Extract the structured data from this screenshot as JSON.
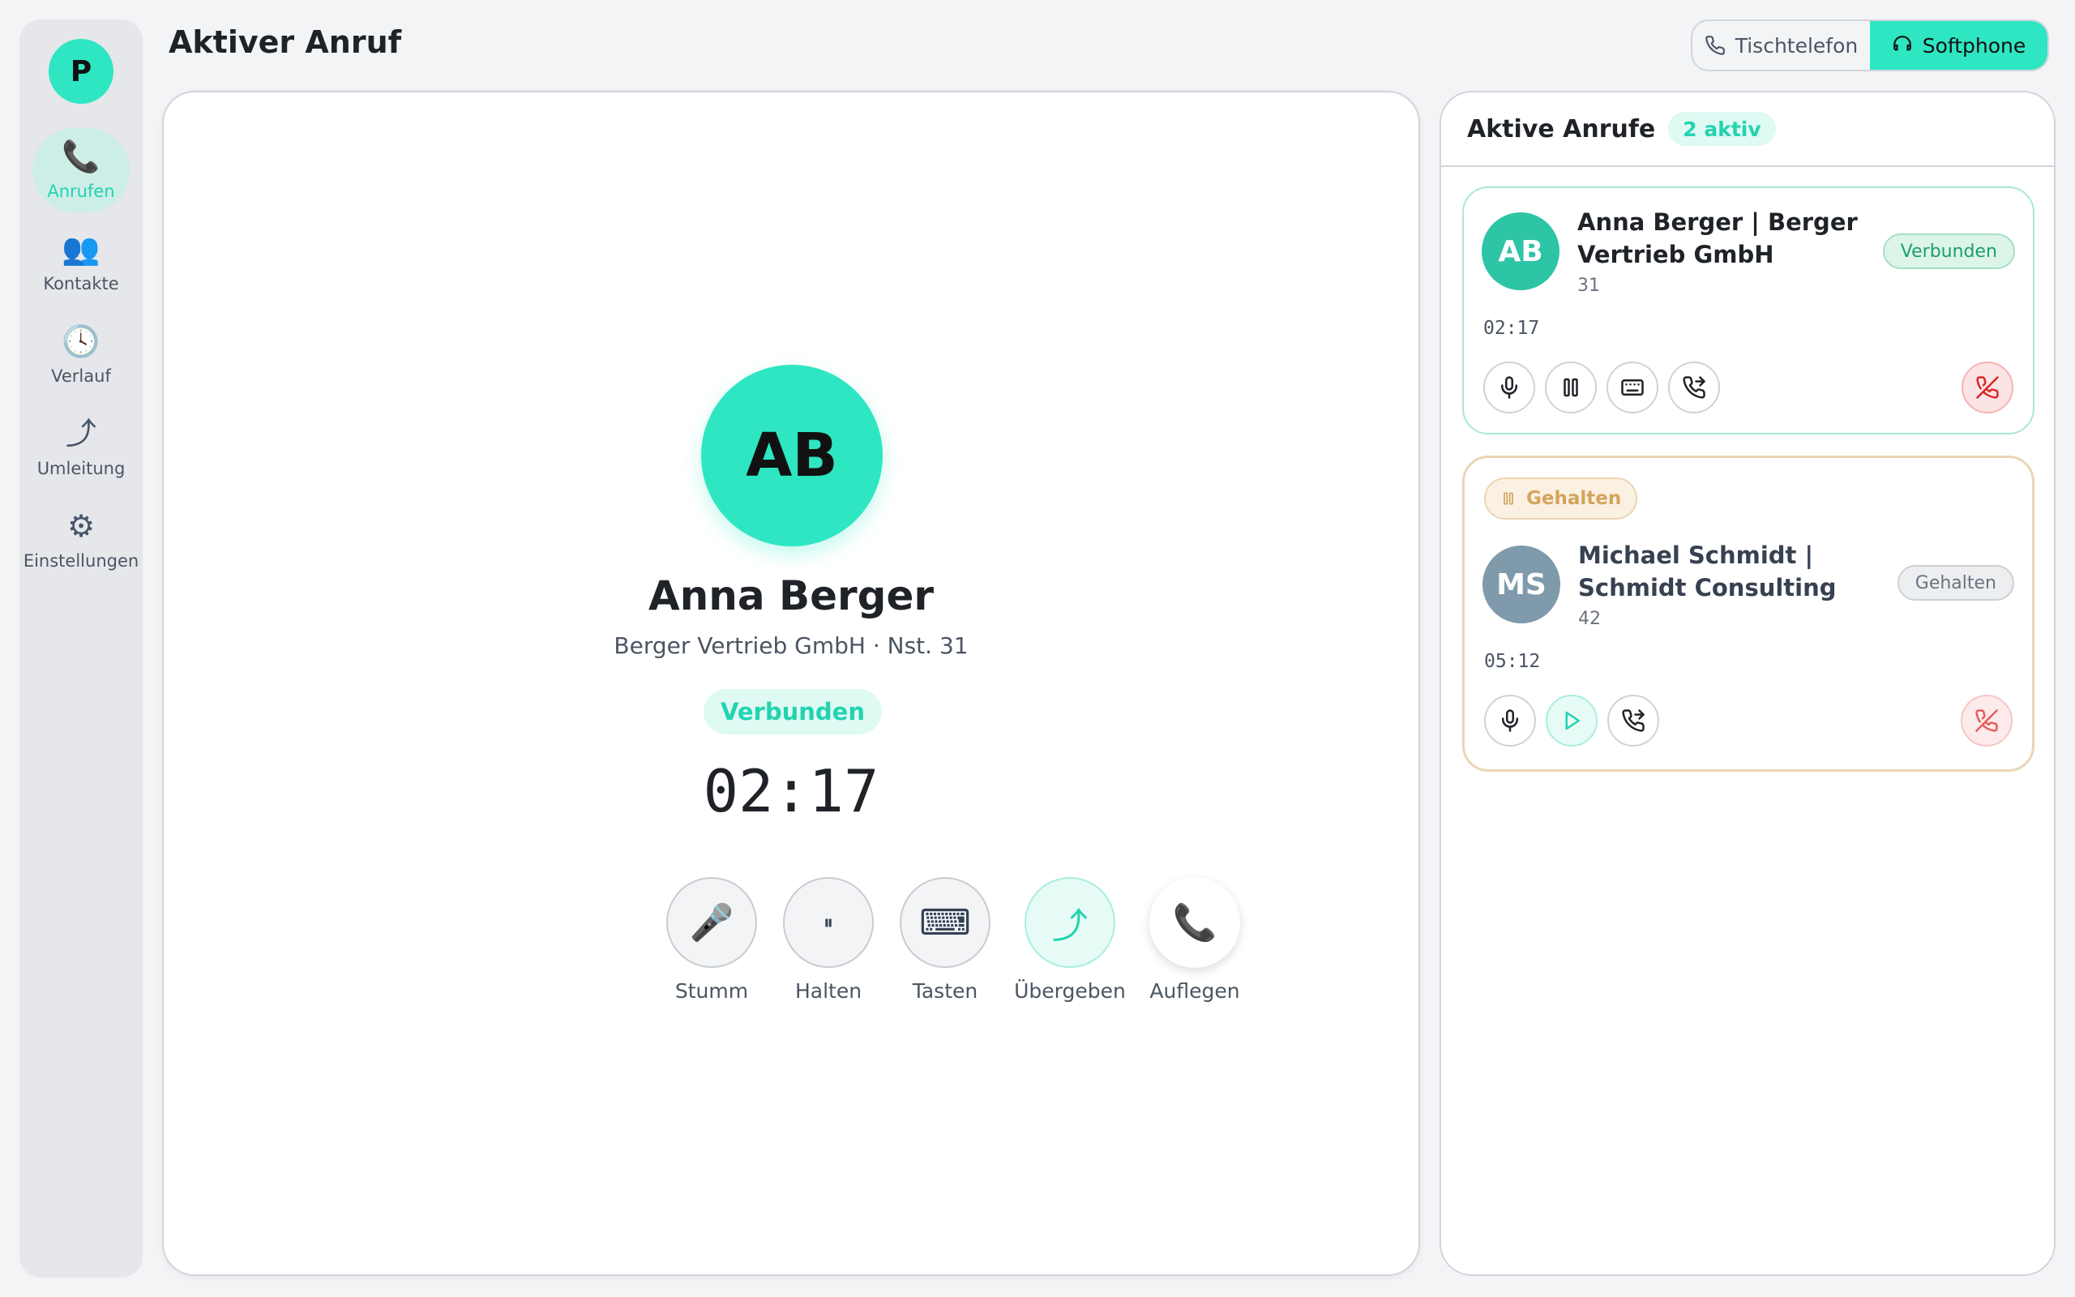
{
  "app": {
    "logo_letter": "P"
  },
  "sidebar": {
    "items": [
      {
        "icon": "phone-icon",
        "glyph": "📞",
        "label": "Anrufen",
        "active": true
      },
      {
        "icon": "contacts-icon",
        "glyph": "👥",
        "label": "Kontakte",
        "active": false
      },
      {
        "icon": "clock-icon",
        "glyph": "🕓",
        "label": "Verlauf",
        "active": false
      },
      {
        "icon": "forward-arrow-icon",
        "glyph": "⤴",
        "label": "Umleitung",
        "active": false
      },
      {
        "icon": "gear-icon",
        "glyph": "⚙",
        "label": "Einstellungen",
        "active": false
      }
    ]
  },
  "header": {
    "title": "Aktiver Anruf",
    "modes": {
      "desk": "Tischtelefon",
      "soft": "Softphone",
      "active": "Softphone"
    }
  },
  "current_call": {
    "initials": "AB",
    "name": "Anna Berger",
    "subtitle": "Berger Vertrieb GmbH · Nst. 31",
    "status": "Verbunden",
    "timer": "02:17",
    "controls": {
      "mute": {
        "glyph": "🎤",
        "label": "Stumm"
      },
      "hold": {
        "glyph": "⏸",
        "label": "Halten"
      },
      "keypad": {
        "glyph": "⌨",
        "label": "Tasten"
      },
      "transfer": {
        "glyph": "⤴",
        "label": "Übergeben"
      },
      "hangup": {
        "glyph": "📞",
        "label": "Auflegen"
      }
    }
  },
  "active_calls": {
    "title": "Aktive Anrufe",
    "badge": "2 aktiv",
    "calls": [
      {
        "initials": "AB",
        "name": "Anna Berger | Berger Vertrieb GmbH",
        "extension": "31",
        "status": "Verbunden",
        "timer": "02:17"
      },
      {
        "held_tag": "Gehalten",
        "initials": "MS",
        "name": "Michael Schmidt | Schmidt Consulting",
        "extension": "42",
        "status": "Gehalten",
        "timer": "05:12"
      }
    ]
  },
  "colors": {
    "accent": "#2ee6c2",
    "accent_text": "#22d3b0",
    "held": "#d4a35c",
    "danger": "#dc2626"
  }
}
